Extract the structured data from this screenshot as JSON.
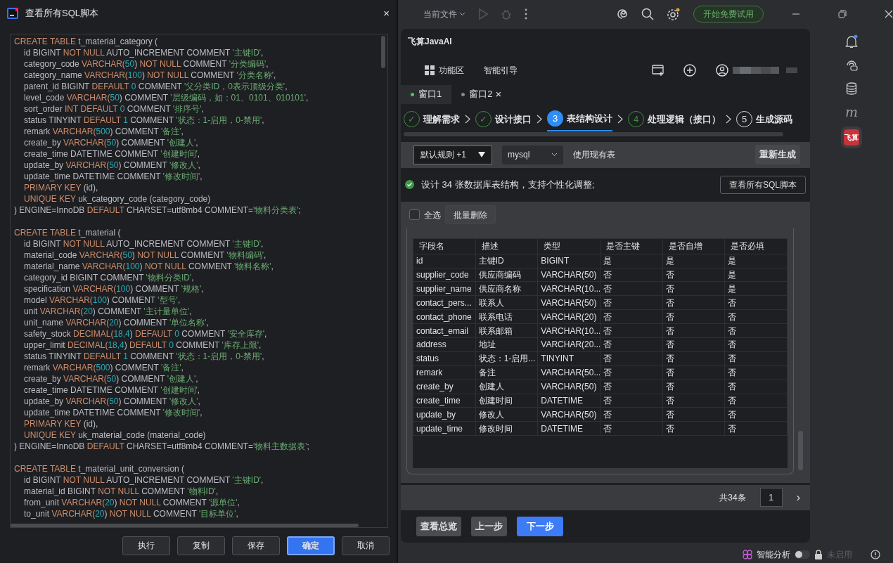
{
  "dialog": {
    "title": "查看所有SQL脚本",
    "close": "×",
    "statements": [
      {
        "lines": [
          {
            "indented": false,
            "segments": [
              {
                "kind": "keyword",
                "text": "CREATE TABLE"
              },
              {
                "kind": "plain",
                "text": " t_material_category ("
              }
            ]
          },
          {
            "indented": true,
            "segments": [
              {
                "kind": "plain",
                "text": "id BIGINT "
              },
              {
                "kind": "keyword",
                "text": "NOT NULL"
              },
              {
                "kind": "plain",
                "text": " AUTO_INCREMENT COMMENT "
              },
              {
                "kind": "string",
                "text": "'主键ID'"
              },
              {
                "kind": "plain",
                "text": ","
              }
            ]
          },
          {
            "indented": true,
            "segments": [
              {
                "kind": "plain",
                "text": "category_code "
              },
              {
                "kind": "keyword",
                "text": "VARCHAR("
              },
              {
                "kind": "number",
                "text": "50"
              },
              {
                "kind": "plain",
                "text": ") "
              },
              {
                "kind": "keyword",
                "text": "NOT NULL"
              },
              {
                "kind": "plain",
                "text": " COMMENT "
              },
              {
                "kind": "string",
                "text": "'分类编码'"
              },
              {
                "kind": "plain",
                "text": ","
              }
            ]
          },
          {
            "indented": true,
            "segments": [
              {
                "kind": "plain",
                "text": "category_name "
              },
              {
                "kind": "keyword",
                "text": "VARCHAR("
              },
              {
                "kind": "number",
                "text": "100"
              },
              {
                "kind": "plain",
                "text": ") "
              },
              {
                "kind": "keyword",
                "text": "NOT NULL"
              },
              {
                "kind": "plain",
                "text": " COMMENT "
              },
              {
                "kind": "string",
                "text": "'分类名称'"
              },
              {
                "kind": "plain",
                "text": ","
              }
            ]
          },
          {
            "indented": true,
            "segments": [
              {
                "kind": "plain",
                "text": "parent_id BIGINT "
              },
              {
                "kind": "keyword",
                "text": "DEFAULT"
              },
              {
                "kind": "number",
                "text": " 0"
              },
              {
                "kind": "plain",
                "text": " COMMENT "
              },
              {
                "kind": "string",
                "text": "'父分类ID，0表示顶级分类'"
              },
              {
                "kind": "plain",
                "text": ","
              }
            ]
          },
          {
            "indented": true,
            "segments": [
              {
                "kind": "plain",
                "text": "level_code "
              },
              {
                "kind": "keyword",
                "text": "VARCHAR("
              },
              {
                "kind": "number",
                "text": "50"
              },
              {
                "kind": "plain",
                "text": ") COMMENT "
              },
              {
                "kind": "string",
                "text": "'层级编码，如：01、0101、010101'"
              },
              {
                "kind": "plain",
                "text": ","
              }
            ]
          },
          {
            "indented": true,
            "segments": [
              {
                "kind": "plain",
                "text": "sort_order "
              },
              {
                "kind": "keyword",
                "text": "INT DEFAULT"
              },
              {
                "kind": "number",
                "text": " 0"
              },
              {
                "kind": "plain",
                "text": " COMMENT "
              },
              {
                "kind": "string",
                "text": "'排序号'"
              },
              {
                "kind": "plain",
                "text": ","
              }
            ]
          },
          {
            "indented": true,
            "segments": [
              {
                "kind": "plain",
                "text": "status TINYINT "
              },
              {
                "kind": "keyword",
                "text": "DEFAULT"
              },
              {
                "kind": "number",
                "text": " 1"
              },
              {
                "kind": "plain",
                "text": " COMMENT "
              },
              {
                "kind": "string",
                "text": "'状态：1-启用，0-禁用'"
              },
              {
                "kind": "plain",
                "text": ","
              }
            ]
          },
          {
            "indented": true,
            "segments": [
              {
                "kind": "plain",
                "text": "remark "
              },
              {
                "kind": "keyword",
                "text": "VARCHAR("
              },
              {
                "kind": "number",
                "text": "500"
              },
              {
                "kind": "plain",
                "text": ") COMMENT "
              },
              {
                "kind": "string",
                "text": "'备注'"
              },
              {
                "kind": "plain",
                "text": ","
              }
            ]
          },
          {
            "indented": true,
            "segments": [
              {
                "kind": "plain",
                "text": "create_by "
              },
              {
                "kind": "keyword",
                "text": "VARCHAR("
              },
              {
                "kind": "number",
                "text": "50"
              },
              {
                "kind": "plain",
                "text": ") COMMENT "
              },
              {
                "kind": "string",
                "text": "'创建人'"
              },
              {
                "kind": "plain",
                "text": ","
              }
            ]
          },
          {
            "indented": true,
            "segments": [
              {
                "kind": "plain",
                "text": "create_time DATETIME COMMENT "
              },
              {
                "kind": "string",
                "text": "'创建时间'"
              },
              {
                "kind": "plain",
                "text": ","
              }
            ]
          },
          {
            "indented": true,
            "segments": [
              {
                "kind": "plain",
                "text": "update_by "
              },
              {
                "kind": "keyword",
                "text": "VARCHAR("
              },
              {
                "kind": "number",
                "text": "50"
              },
              {
                "kind": "plain",
                "text": ") COMMENT "
              },
              {
                "kind": "string",
                "text": "'修改人'"
              },
              {
                "kind": "plain",
                "text": ","
              }
            ]
          },
          {
            "indented": true,
            "segments": [
              {
                "kind": "plain",
                "text": "update_time DATETIME COMMENT "
              },
              {
                "kind": "string",
                "text": "'修改时间'"
              },
              {
                "kind": "plain",
                "text": ","
              }
            ]
          },
          {
            "indented": true,
            "segments": [
              {
                "kind": "keyword",
                "text": "PRIMARY KEY"
              },
              {
                "kind": "plain",
                "text": " (id),"
              }
            ]
          },
          {
            "indented": true,
            "segments": [
              {
                "kind": "keyword",
                "text": "UNIQUE KEY"
              },
              {
                "kind": "plain",
                "text": " uk_category_code (category_code)"
              }
            ]
          },
          {
            "indented": false,
            "segments": [
              {
                "kind": "plain",
                "text": ") ENGINE=InnoDB "
              },
              {
                "kind": "keyword",
                "text": "DEFAULT"
              },
              {
                "kind": "plain",
                "text": " CHARSET=utf8mb4 COMMENT="
              },
              {
                "kind": "string",
                "text": "'物料分类表'"
              },
              {
                "kind": "plain",
                "text": ";"
              }
            ]
          }
        ]
      },
      {
        "lines": [
          {
            "indented": false,
            "segments": [
              {
                "kind": "keyword",
                "text": "CREATE TABLE"
              },
              {
                "kind": "plain",
                "text": " t_material ("
              }
            ]
          },
          {
            "indented": true,
            "segments": [
              {
                "kind": "plain",
                "text": "id BIGINT "
              },
              {
                "kind": "keyword",
                "text": "NOT NULL"
              },
              {
                "kind": "plain",
                "text": " AUTO_INCREMENT COMMENT "
              },
              {
                "kind": "string",
                "text": "'主键ID'"
              },
              {
                "kind": "plain",
                "text": ","
              }
            ]
          },
          {
            "indented": true,
            "segments": [
              {
                "kind": "plain",
                "text": "material_code "
              },
              {
                "kind": "keyword",
                "text": "VARCHAR("
              },
              {
                "kind": "number",
                "text": "50"
              },
              {
                "kind": "plain",
                "text": ") "
              },
              {
                "kind": "keyword",
                "text": "NOT NULL"
              },
              {
                "kind": "plain",
                "text": " COMMENT "
              },
              {
                "kind": "string",
                "text": "'物料编码'"
              },
              {
                "kind": "plain",
                "text": ","
              }
            ]
          },
          {
            "indented": true,
            "segments": [
              {
                "kind": "plain",
                "text": "material_name "
              },
              {
                "kind": "keyword",
                "text": "VARCHAR("
              },
              {
                "kind": "number",
                "text": "100"
              },
              {
                "kind": "plain",
                "text": ") "
              },
              {
                "kind": "keyword",
                "text": "NOT NULL"
              },
              {
                "kind": "plain",
                "text": " COMMENT "
              },
              {
                "kind": "string",
                "text": "'物料名称'"
              },
              {
                "kind": "plain",
                "text": ","
              }
            ]
          },
          {
            "indented": true,
            "segments": [
              {
                "kind": "plain",
                "text": "category_id BIGINT COMMENT "
              },
              {
                "kind": "string",
                "text": "'物料分类ID'"
              },
              {
                "kind": "plain",
                "text": ","
              }
            ]
          },
          {
            "indented": true,
            "segments": [
              {
                "kind": "plain",
                "text": "specification "
              },
              {
                "kind": "keyword",
                "text": "VARCHAR("
              },
              {
                "kind": "number",
                "text": "100"
              },
              {
                "kind": "plain",
                "text": ") COMMENT "
              },
              {
                "kind": "string",
                "text": "'规格'"
              },
              {
                "kind": "plain",
                "text": ","
              }
            ]
          },
          {
            "indented": true,
            "segments": [
              {
                "kind": "plain",
                "text": "model "
              },
              {
                "kind": "keyword",
                "text": "VARCHAR("
              },
              {
                "kind": "number",
                "text": "100"
              },
              {
                "kind": "plain",
                "text": ") COMMENT "
              },
              {
                "kind": "string",
                "text": "'型号'"
              },
              {
                "kind": "plain",
                "text": ","
              }
            ]
          },
          {
            "indented": true,
            "segments": [
              {
                "kind": "plain",
                "text": "unit "
              },
              {
                "kind": "keyword",
                "text": "VARCHAR("
              },
              {
                "kind": "number",
                "text": "20"
              },
              {
                "kind": "plain",
                "text": ") COMMENT "
              },
              {
                "kind": "string",
                "text": "'主计量单位'"
              },
              {
                "kind": "plain",
                "text": ","
              }
            ]
          },
          {
            "indented": true,
            "segments": [
              {
                "kind": "plain",
                "text": "unit_name "
              },
              {
                "kind": "keyword",
                "text": "VARCHAR("
              },
              {
                "kind": "number",
                "text": "20"
              },
              {
                "kind": "plain",
                "text": ") COMMENT "
              },
              {
                "kind": "string",
                "text": "'单位名称'"
              },
              {
                "kind": "plain",
                "text": ","
              }
            ]
          },
          {
            "indented": true,
            "segments": [
              {
                "kind": "plain",
                "text": "safety_stock "
              },
              {
                "kind": "keyword",
                "text": "DECIMAL("
              },
              {
                "kind": "number",
                "text": "18,4"
              },
              {
                "kind": "plain",
                "text": ") "
              },
              {
                "kind": "keyword",
                "text": "DEFAULT"
              },
              {
                "kind": "number",
                "text": " 0"
              },
              {
                "kind": "plain",
                "text": " COMMENT "
              },
              {
                "kind": "string",
                "text": "'安全库存'"
              },
              {
                "kind": "plain",
                "text": ","
              }
            ]
          },
          {
            "indented": true,
            "segments": [
              {
                "kind": "plain",
                "text": "upper_limit "
              },
              {
                "kind": "keyword",
                "text": "DECIMAL("
              },
              {
                "kind": "number",
                "text": "18,4"
              },
              {
                "kind": "plain",
                "text": ") "
              },
              {
                "kind": "keyword",
                "text": "DEFAULT"
              },
              {
                "kind": "number",
                "text": " 0"
              },
              {
                "kind": "plain",
                "text": " COMMENT "
              },
              {
                "kind": "string",
                "text": "'库存上限'"
              },
              {
                "kind": "plain",
                "text": ","
              }
            ]
          },
          {
            "indented": true,
            "segments": [
              {
                "kind": "plain",
                "text": "status TINYINT "
              },
              {
                "kind": "keyword",
                "text": "DEFAULT"
              },
              {
                "kind": "number",
                "text": " 1"
              },
              {
                "kind": "plain",
                "text": " COMMENT "
              },
              {
                "kind": "string",
                "text": "'状态：1-启用，0-禁用'"
              },
              {
                "kind": "plain",
                "text": ","
              }
            ]
          },
          {
            "indented": true,
            "segments": [
              {
                "kind": "plain",
                "text": "remark "
              },
              {
                "kind": "keyword",
                "text": "VARCHAR("
              },
              {
                "kind": "number",
                "text": "500"
              },
              {
                "kind": "plain",
                "text": ") COMMENT "
              },
              {
                "kind": "string",
                "text": "'备注'"
              },
              {
                "kind": "plain",
                "text": ","
              }
            ]
          },
          {
            "indented": true,
            "segments": [
              {
                "kind": "plain",
                "text": "create_by "
              },
              {
                "kind": "keyword",
                "text": "VARCHAR("
              },
              {
                "kind": "number",
                "text": "50"
              },
              {
                "kind": "plain",
                "text": ") COMMENT "
              },
              {
                "kind": "string",
                "text": "'创建人'"
              },
              {
                "kind": "plain",
                "text": ","
              }
            ]
          },
          {
            "indented": true,
            "segments": [
              {
                "kind": "plain",
                "text": "create_time DATETIME COMMENT "
              },
              {
                "kind": "string",
                "text": "'创建时间'"
              },
              {
                "kind": "plain",
                "text": ","
              }
            ]
          },
          {
            "indented": true,
            "segments": [
              {
                "kind": "plain",
                "text": "update_by "
              },
              {
                "kind": "keyword",
                "text": "VARCHAR("
              },
              {
                "kind": "number",
                "text": "50"
              },
              {
                "kind": "plain",
                "text": ") COMMENT "
              },
              {
                "kind": "string",
                "text": "'修改人'"
              },
              {
                "kind": "plain",
                "text": ","
              }
            ]
          },
          {
            "indented": true,
            "segments": [
              {
                "kind": "plain",
                "text": "update_time DATETIME COMMENT "
              },
              {
                "kind": "string",
                "text": "'修改时间'"
              },
              {
                "kind": "plain",
                "text": ","
              }
            ]
          },
          {
            "indented": true,
            "segments": [
              {
                "kind": "keyword",
                "text": "PRIMARY KEY"
              },
              {
                "kind": "plain",
                "text": " (id),"
              }
            ]
          },
          {
            "indented": true,
            "segments": [
              {
                "kind": "keyword",
                "text": "UNIQUE KEY"
              },
              {
                "kind": "plain",
                "text": " uk_material_code (material_code)"
              }
            ]
          },
          {
            "indented": false,
            "segments": [
              {
                "kind": "plain",
                "text": ") ENGINE=InnoDB "
              },
              {
                "kind": "keyword",
                "text": "DEFAULT"
              },
              {
                "kind": "plain",
                "text": " CHARSET=utf8mb4 COMMENT="
              },
              {
                "kind": "string",
                "text": "'物料主数据表'"
              },
              {
                "kind": "plain",
                "text": ";"
              }
            ]
          }
        ]
      },
      {
        "lines": [
          {
            "indented": false,
            "segments": [
              {
                "kind": "keyword",
                "text": "CREATE TABLE"
              },
              {
                "kind": "plain",
                "text": " t_material_unit_conversion ("
              }
            ]
          },
          {
            "indented": true,
            "segments": [
              {
                "kind": "plain",
                "text": "id BIGINT "
              },
              {
                "kind": "keyword",
                "text": "NOT NULL"
              },
              {
                "kind": "plain",
                "text": " AUTO_INCREMENT COMMENT "
              },
              {
                "kind": "string",
                "text": "'主键ID'"
              },
              {
                "kind": "plain",
                "text": ","
              }
            ]
          },
          {
            "indented": true,
            "segments": [
              {
                "kind": "plain",
                "text": "material_id BIGINT "
              },
              {
                "kind": "keyword",
                "text": "NOT NULL"
              },
              {
                "kind": "plain",
                "text": " COMMENT "
              },
              {
                "kind": "string",
                "text": "'物料ID'"
              },
              {
                "kind": "plain",
                "text": ","
              }
            ]
          },
          {
            "indented": true,
            "segments": [
              {
                "kind": "plain",
                "text": "from_unit "
              },
              {
                "kind": "keyword",
                "text": "VARCHAR("
              },
              {
                "kind": "number",
                "text": "20"
              },
              {
                "kind": "plain",
                "text": ") "
              },
              {
                "kind": "keyword",
                "text": "NOT NULL"
              },
              {
                "kind": "plain",
                "text": " COMMENT "
              },
              {
                "kind": "string",
                "text": "'源单位'"
              },
              {
                "kind": "plain",
                "text": ","
              }
            ]
          },
          {
            "indented": true,
            "segments": [
              {
                "kind": "plain",
                "text": "to_unit "
              },
              {
                "kind": "keyword",
                "text": "VARCHAR("
              },
              {
                "kind": "number",
                "text": "20"
              },
              {
                "kind": "plain",
                "text": ") "
              },
              {
                "kind": "keyword",
                "text": "NOT NULL"
              },
              {
                "kind": "plain",
                "text": " COMMENT "
              },
              {
                "kind": "string",
                "text": "'目标单位'"
              },
              {
                "kind": "plain",
                "text": ","
              }
            ]
          }
        ]
      }
    ],
    "buttons": [
      {
        "label": "执行",
        "primary": false
      },
      {
        "label": "复制",
        "primary": false
      },
      {
        "label": "保存",
        "primary": false
      },
      {
        "label": "确定",
        "primary": true
      },
      {
        "label": "取消",
        "primary": false
      }
    ]
  },
  "ide": {
    "toolbar": {
      "run_config": "当前文件",
      "trial_button": "开始免费试用"
    },
    "plugin": {
      "title": "飞算JavaAI",
      "nav": [
        {
          "label": "功能区",
          "kind": "grid"
        },
        {
          "label": "智能引导",
          "kind": "plain"
        }
      ],
      "tabs": [
        {
          "label": "窗口1",
          "selected": true,
          "closable": false
        },
        {
          "label": "窗口2",
          "selected": false,
          "closable": true,
          "close": "×"
        }
      ],
      "steps": [
        {
          "marker": "✓",
          "label": "理解需求",
          "kind": "done"
        },
        {
          "marker": "✓",
          "label": "设计接口",
          "kind": "done"
        },
        {
          "marker": "3",
          "label": "表结构设计",
          "kind": "current"
        },
        {
          "marker": "4",
          "label": "处理逻辑（接口）",
          "kind": "next"
        },
        {
          "marker": "5",
          "label": "生成源码",
          "kind": "todo"
        }
      ],
      "rule_select": "默认规则 +1",
      "db_select": "mysql",
      "use_existing": "使用现有表",
      "regenerate": "重新生成",
      "summary": "设计 34 张数据库表结构，支持个性化调整;",
      "view_sql": "查看所有SQL脚本",
      "select_all": {
        "label": "全选",
        "checked": false
      },
      "batch_delete": "批量删除",
      "table": {
        "columns": [
          "字段名",
          "描述",
          "类型",
          "是否主键",
          "是否自增",
          "是否必填"
        ],
        "rows": [
          [
            "id",
            "主键ID",
            "BIGINT",
            "是",
            "是",
            "是"
          ],
          [
            "supplier_code",
            "供应商编码",
            "VARCHAR(50)",
            "否",
            "否",
            "是"
          ],
          [
            "supplier_name",
            "供应商名称",
            "VARCHAR(10...",
            "否",
            "否",
            "是"
          ],
          [
            "contact_pers...",
            "联系人",
            "VARCHAR(50)",
            "否",
            "否",
            "否"
          ],
          [
            "contact_phone",
            "联系电话",
            "VARCHAR(20)",
            "否",
            "否",
            "否"
          ],
          [
            "contact_email",
            "联系邮箱",
            "VARCHAR(10...",
            "否",
            "否",
            "否"
          ],
          [
            "address",
            "地址",
            "VARCHAR(20...",
            "否",
            "否",
            "否"
          ],
          [
            "status",
            "状态：1-启用...",
            "TINYINT",
            "否",
            "否",
            "否"
          ],
          [
            "remark",
            "备注",
            "VARCHAR(50...",
            "否",
            "否",
            "否"
          ],
          [
            "create_by",
            "创建人",
            "VARCHAR(50)",
            "否",
            "否",
            "否"
          ],
          [
            "create_time",
            "创建时间",
            "DATETIME",
            "否",
            "否",
            "否"
          ],
          [
            "update_by",
            "修改人",
            "VARCHAR(50)",
            "否",
            "否",
            "否"
          ],
          [
            "update_time",
            "修改时间",
            "DATETIME",
            "否",
            "否",
            "否"
          ]
        ]
      },
      "total": "共34条",
      "page": "1",
      "next_page": "›",
      "footer_buttons": [
        {
          "label": "查看总览",
          "primary": false
        },
        {
          "label": "上一步",
          "primary": false
        },
        {
          "label": "下一步",
          "primary": true
        }
      ]
    },
    "side_logos": {
      "m_letter": "m",
      "brand": "飞算"
    },
    "status_bar": {
      "analysis": "智能分析",
      "analysis_on": false,
      "lock_label": "未启用"
    }
  }
}
